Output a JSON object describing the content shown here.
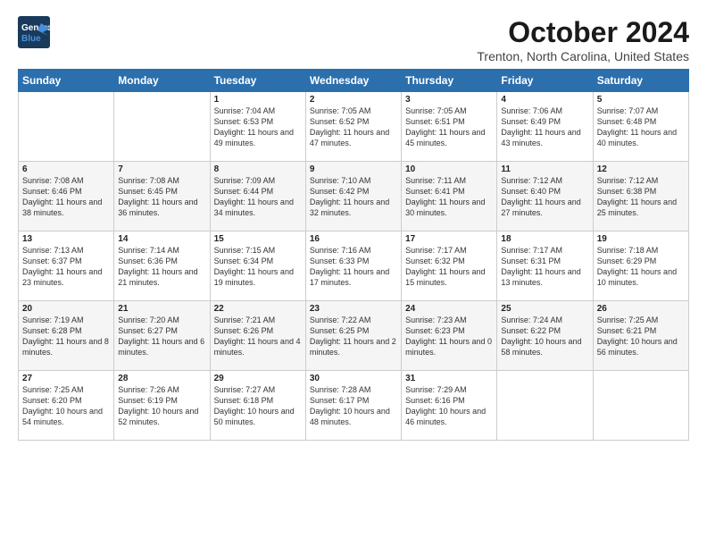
{
  "header": {
    "logo_line1": "General",
    "logo_line2": "Blue",
    "title": "October 2024",
    "subtitle": "Trenton, North Carolina, United States"
  },
  "days_of_week": [
    "Sunday",
    "Monday",
    "Tuesday",
    "Wednesday",
    "Thursday",
    "Friday",
    "Saturday"
  ],
  "weeks": [
    [
      {
        "day": "",
        "info": ""
      },
      {
        "day": "",
        "info": ""
      },
      {
        "day": "1",
        "info": "Sunrise: 7:04 AM\nSunset: 6:53 PM\nDaylight: 11 hours and 49 minutes."
      },
      {
        "day": "2",
        "info": "Sunrise: 7:05 AM\nSunset: 6:52 PM\nDaylight: 11 hours and 47 minutes."
      },
      {
        "day": "3",
        "info": "Sunrise: 7:05 AM\nSunset: 6:51 PM\nDaylight: 11 hours and 45 minutes."
      },
      {
        "day": "4",
        "info": "Sunrise: 7:06 AM\nSunset: 6:49 PM\nDaylight: 11 hours and 43 minutes."
      },
      {
        "day": "5",
        "info": "Sunrise: 7:07 AM\nSunset: 6:48 PM\nDaylight: 11 hours and 40 minutes."
      }
    ],
    [
      {
        "day": "6",
        "info": "Sunrise: 7:08 AM\nSunset: 6:46 PM\nDaylight: 11 hours and 38 minutes."
      },
      {
        "day": "7",
        "info": "Sunrise: 7:08 AM\nSunset: 6:45 PM\nDaylight: 11 hours and 36 minutes."
      },
      {
        "day": "8",
        "info": "Sunrise: 7:09 AM\nSunset: 6:44 PM\nDaylight: 11 hours and 34 minutes."
      },
      {
        "day": "9",
        "info": "Sunrise: 7:10 AM\nSunset: 6:42 PM\nDaylight: 11 hours and 32 minutes."
      },
      {
        "day": "10",
        "info": "Sunrise: 7:11 AM\nSunset: 6:41 PM\nDaylight: 11 hours and 30 minutes."
      },
      {
        "day": "11",
        "info": "Sunrise: 7:12 AM\nSunset: 6:40 PM\nDaylight: 11 hours and 27 minutes."
      },
      {
        "day": "12",
        "info": "Sunrise: 7:12 AM\nSunset: 6:38 PM\nDaylight: 11 hours and 25 minutes."
      }
    ],
    [
      {
        "day": "13",
        "info": "Sunrise: 7:13 AM\nSunset: 6:37 PM\nDaylight: 11 hours and 23 minutes."
      },
      {
        "day": "14",
        "info": "Sunrise: 7:14 AM\nSunset: 6:36 PM\nDaylight: 11 hours and 21 minutes."
      },
      {
        "day": "15",
        "info": "Sunrise: 7:15 AM\nSunset: 6:34 PM\nDaylight: 11 hours and 19 minutes."
      },
      {
        "day": "16",
        "info": "Sunrise: 7:16 AM\nSunset: 6:33 PM\nDaylight: 11 hours and 17 minutes."
      },
      {
        "day": "17",
        "info": "Sunrise: 7:17 AM\nSunset: 6:32 PM\nDaylight: 11 hours and 15 minutes."
      },
      {
        "day": "18",
        "info": "Sunrise: 7:17 AM\nSunset: 6:31 PM\nDaylight: 11 hours and 13 minutes."
      },
      {
        "day": "19",
        "info": "Sunrise: 7:18 AM\nSunset: 6:29 PM\nDaylight: 11 hours and 10 minutes."
      }
    ],
    [
      {
        "day": "20",
        "info": "Sunrise: 7:19 AM\nSunset: 6:28 PM\nDaylight: 11 hours and 8 minutes."
      },
      {
        "day": "21",
        "info": "Sunrise: 7:20 AM\nSunset: 6:27 PM\nDaylight: 11 hours and 6 minutes."
      },
      {
        "day": "22",
        "info": "Sunrise: 7:21 AM\nSunset: 6:26 PM\nDaylight: 11 hours and 4 minutes."
      },
      {
        "day": "23",
        "info": "Sunrise: 7:22 AM\nSunset: 6:25 PM\nDaylight: 11 hours and 2 minutes."
      },
      {
        "day": "24",
        "info": "Sunrise: 7:23 AM\nSunset: 6:23 PM\nDaylight: 11 hours and 0 minutes."
      },
      {
        "day": "25",
        "info": "Sunrise: 7:24 AM\nSunset: 6:22 PM\nDaylight: 10 hours and 58 minutes."
      },
      {
        "day": "26",
        "info": "Sunrise: 7:25 AM\nSunset: 6:21 PM\nDaylight: 10 hours and 56 minutes."
      }
    ],
    [
      {
        "day": "27",
        "info": "Sunrise: 7:25 AM\nSunset: 6:20 PM\nDaylight: 10 hours and 54 minutes."
      },
      {
        "day": "28",
        "info": "Sunrise: 7:26 AM\nSunset: 6:19 PM\nDaylight: 10 hours and 52 minutes."
      },
      {
        "day": "29",
        "info": "Sunrise: 7:27 AM\nSunset: 6:18 PM\nDaylight: 10 hours and 50 minutes."
      },
      {
        "day": "30",
        "info": "Sunrise: 7:28 AM\nSunset: 6:17 PM\nDaylight: 10 hours and 48 minutes."
      },
      {
        "day": "31",
        "info": "Sunrise: 7:29 AM\nSunset: 6:16 PM\nDaylight: 10 hours and 46 minutes."
      },
      {
        "day": "",
        "info": ""
      },
      {
        "day": "",
        "info": ""
      }
    ]
  ]
}
